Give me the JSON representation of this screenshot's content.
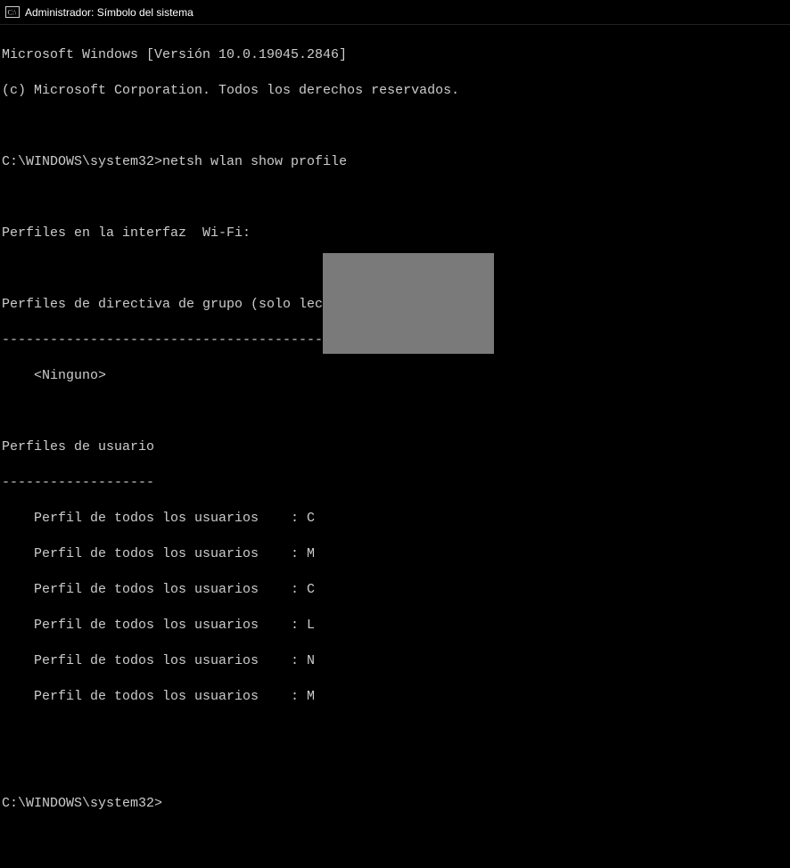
{
  "titlebar": {
    "title": "Administrador: Símbolo del sistema"
  },
  "header": {
    "line1": "Microsoft Windows [Versión 10.0.19045.2846]",
    "line2": "(c) Microsoft Corporation. Todos los derechos reservados."
  },
  "prompt1": {
    "path": "C:\\WINDOWS\\system32>",
    "command": "netsh wlan show profile"
  },
  "output": {
    "interfaceHeader": "Perfiles en la interfaz  Wi-Fi:",
    "groupPolicyHeader": "Perfiles de directiva de grupo (solo lectura)",
    "dashLineLong": "---------------------------------------------",
    "groupPolicyEmpty": "    <Ninguno>",
    "userHeader": "Perfiles de usuario",
    "dashLineShort": "-------------------",
    "profiles": [
      "    Perfil de todos los usuarios    : C",
      "    Perfil de todos los usuarios    : M",
      "    Perfil de todos los usuarios    : C",
      "    Perfil de todos los usuarios    : L",
      "    Perfil de todos los usuarios    : N",
      "    Perfil de todos los usuarios    : M"
    ]
  },
  "prompt2": {
    "path": "C:\\WINDOWS\\system32>"
  }
}
